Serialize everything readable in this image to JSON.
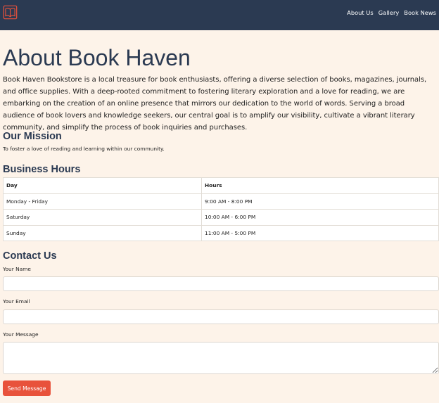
{
  "nav": {
    "logo_icon": "open-book-logo-icon",
    "links": [
      {
        "label": "About Us"
      },
      {
        "label": "Gallery"
      },
      {
        "label": "Book News"
      }
    ]
  },
  "page": {
    "title": "About Book Haven",
    "intro": "Book Haven Bookstore is a local treasure for book enthusiasts, offering a diverse selection of books, magazines, journals, and office supplies. With a deep-rooted commitment to fostering literary exploration and a love for reading, we are embarking on the creation of an online presence that mirrors our dedication to the world of words. Serving a broad audience of book lovers and knowledge seekers, our central goal is to amplify our visibility, cultivate a vibrant literary community, and simplify the process of book inquiries and purchases."
  },
  "mission": {
    "heading": "Our Mission",
    "text": "To foster a love of reading and learning within our community."
  },
  "hours": {
    "heading": "Business Hours",
    "columns": [
      "Day",
      "Hours"
    ],
    "rows": [
      [
        "Monday - Friday",
        "9:00 AM - 8:00 PM"
      ],
      [
        "Saturday",
        "10:00 AM - 6:00 PM"
      ],
      [
        "Sunday",
        "11:00 AM - 5:00 PM"
      ]
    ]
  },
  "contact": {
    "heading": "Contact Us",
    "name_label": "Your Name",
    "name_value": "",
    "email_label": "Your Email",
    "email_value": "",
    "message_label": "Your Message",
    "message_value": "",
    "send_label": "Send Message"
  },
  "colors": {
    "navbar": "#2b3a52",
    "background": "#fdf3e9",
    "accent": "#e8523b",
    "heading": "#2b3a52"
  }
}
